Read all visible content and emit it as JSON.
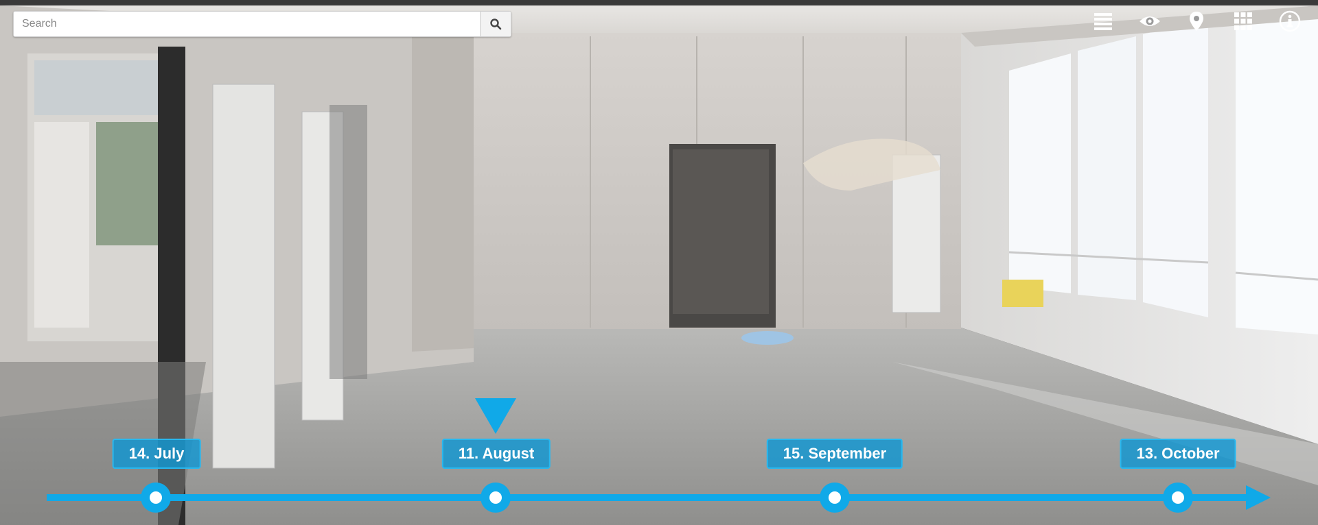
{
  "search": {
    "placeholder": "Search",
    "value": ""
  },
  "toolbar": {
    "icons": [
      "list-icon",
      "eye-icon",
      "map-pin-icon",
      "grid-icon",
      "info-icon"
    ]
  },
  "timeline": {
    "dates": [
      {
        "label": "14. July"
      },
      {
        "label": "11. August"
      },
      {
        "label": "15. September"
      },
      {
        "label": "13. October"
      }
    ],
    "selected_index": 1
  },
  "colors": {
    "accent": "#10a9e8"
  }
}
